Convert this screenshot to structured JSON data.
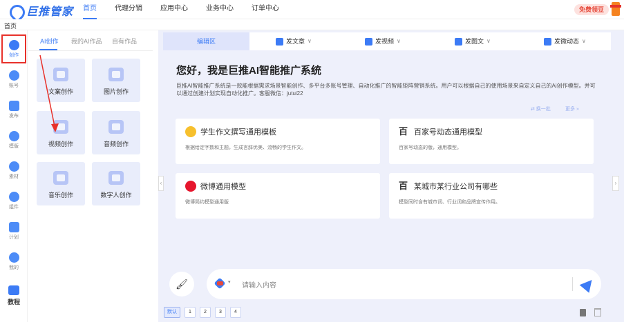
{
  "brand": {
    "name": "巨推管家"
  },
  "nav": {
    "items": [
      "首页",
      "代理分销",
      "应用中心",
      "业务中心",
      "订单中心"
    ],
    "active": 0
  },
  "header": {
    "free_button": "免费领豆"
  },
  "breadcrumb": {
    "current": "首页"
  },
  "rail": {
    "items": [
      {
        "label": "创作",
        "icon": "pen-icon"
      },
      {
        "label": "账号",
        "icon": "users-icon"
      },
      {
        "label": "发布",
        "icon": "publish-icon"
      },
      {
        "label": "模版",
        "icon": "template-icon"
      },
      {
        "label": "素材",
        "icon": "cloud-icon"
      },
      {
        "label": "组件",
        "icon": "puzzle-icon"
      },
      {
        "label": "计划",
        "icon": "calendar-icon"
      },
      {
        "label": "我的",
        "icon": "user-icon"
      }
    ],
    "tutorial": "教程"
  },
  "subpanel": {
    "tabs": [
      "AI创作",
      "我的AI作品",
      "自有作品"
    ],
    "cards": [
      "文案创作",
      "图片创作",
      "视频创作",
      "音频创作",
      "音乐创作",
      "数字人创作"
    ]
  },
  "main": {
    "tabs": [
      {
        "label": "编辑区"
      },
      {
        "label": "发文章",
        "icon": "article-icon"
      },
      {
        "label": "发视频",
        "icon": "video-icon"
      },
      {
        "label": "发图文",
        "icon": "image-icon"
      },
      {
        "label": "发微动态",
        "icon": "moment-icon"
      }
    ],
    "welcome": "您好，我是巨推AI智能推广系统",
    "intro": "巨推AI智能推广系统是一款能根据需求场景智能创作、多平台多账号管理、自动化推广的智能矩阵营销系统。用户可以根据自己的使用场景来自定义自己的Ai创作模型。并可以通过创建计划实现自动化推广。客服微信：jutui22",
    "refresh": "⇄ 换一批",
    "more": "更多 »",
    "models": [
      {
        "title": "学生作文撰写通用模板",
        "desc": "根据给定字数和主题，生成言辞优美、流畅的学生作文。",
        "icon": "sun-icon"
      },
      {
        "title": "百家号动态通用模型",
        "desc": "百家号动态的版，通用模型。",
        "icon": "baijiahao-icon"
      },
      {
        "title": "微博通用模型",
        "desc": "微博简约模型通用版",
        "icon": "weibo-icon"
      },
      {
        "title": "某城市某行业公司有哪些",
        "desc": "模型同时含有城市词、行业词和品牌宣传作用。",
        "icon": "baijiahao-icon"
      }
    ],
    "input_placeholder": "请输入内容",
    "pages": [
      "默认",
      "1",
      "2",
      "3",
      "4"
    ]
  },
  "colors": {
    "accent": "#3c7bf5",
    "highlight": "#e8312a",
    "panel_bg": "#eef0fb"
  }
}
